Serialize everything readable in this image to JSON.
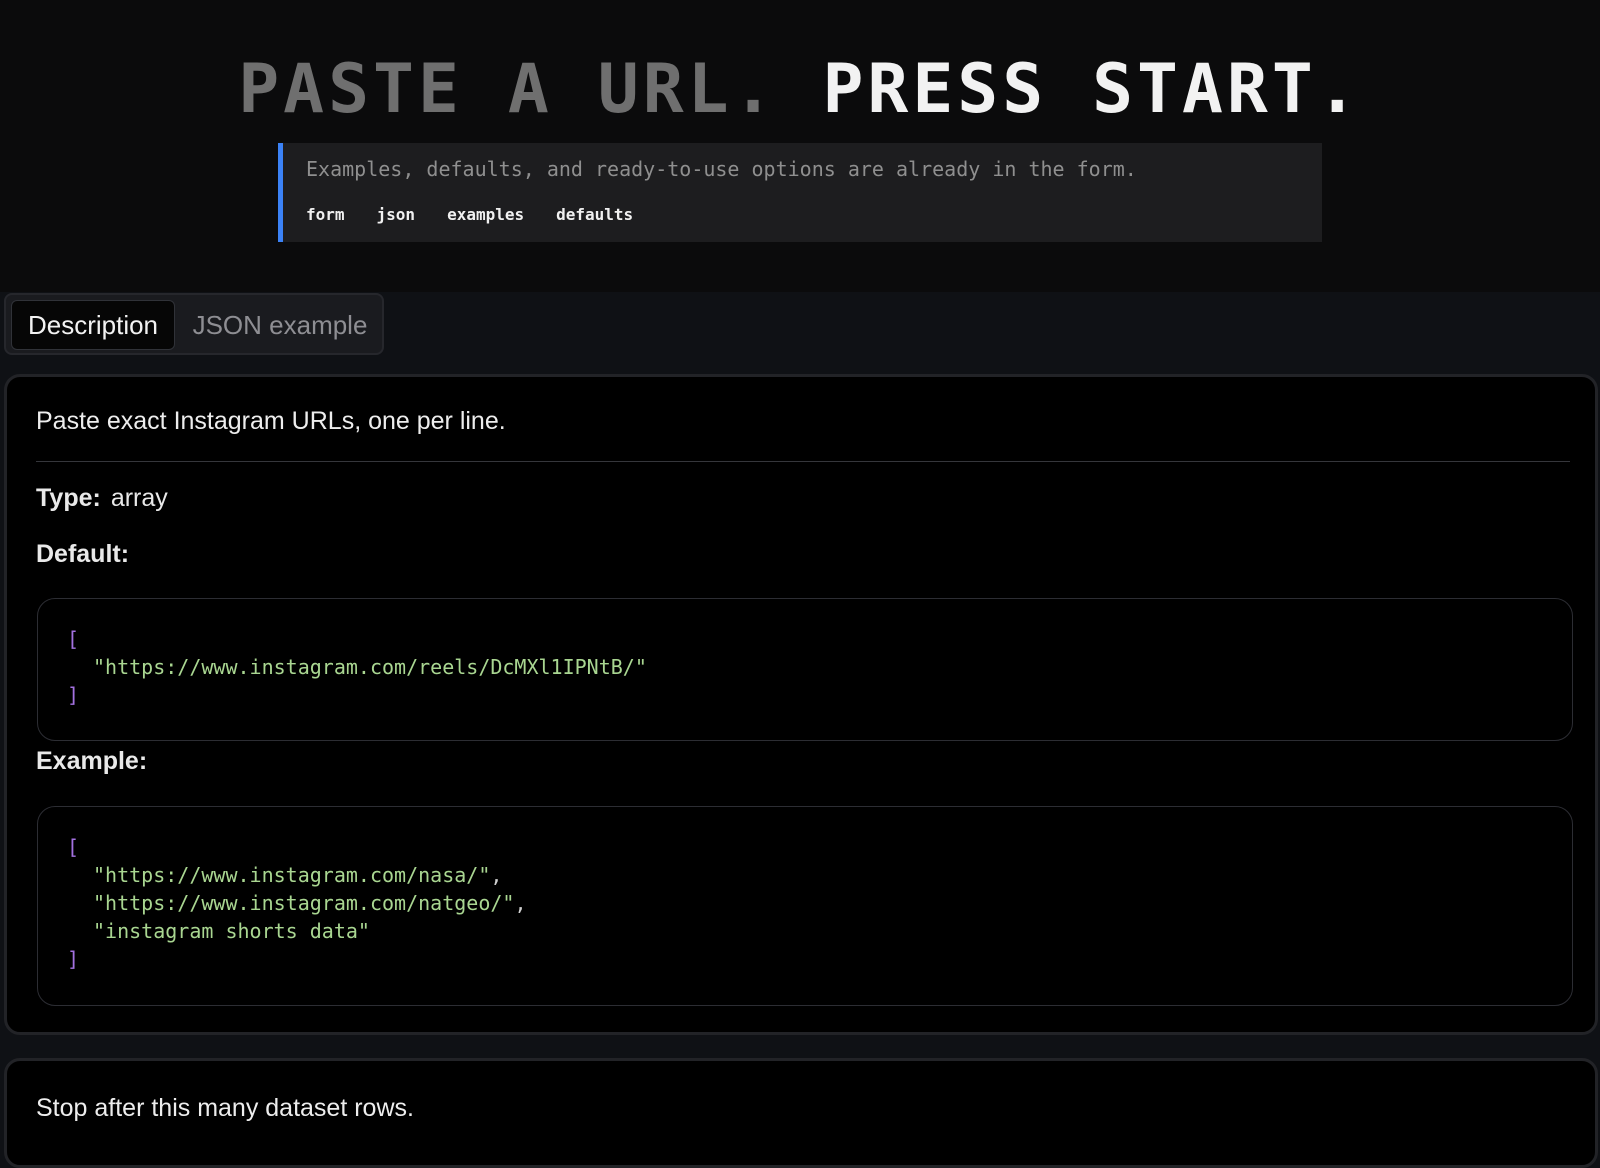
{
  "hero": {
    "title_dim": "PASTE A URL.",
    "title_bright": "PRESS START.",
    "subtitle": "Examples, defaults, and ready-to-use options are already in the form.",
    "tags": [
      "form",
      "json",
      "examples",
      "defaults"
    ],
    "accent_color": "#3b82f6"
  },
  "tabs": {
    "active_label": "Description",
    "inactive_label": "JSON example"
  },
  "field_urls": {
    "description": "Paste exact Instagram URLs, one per line.",
    "type_label": "Type:",
    "type_value": "array",
    "default_label": "Default:",
    "default_open": "[",
    "default_items": [
      "\"https://www.instagram.com/reels/DcMXl1IPNtB/\""
    ],
    "default_close": "]",
    "example_label": "Example:",
    "example_open": "[",
    "example_items": [
      "\"https://www.instagram.com/nasa/\"",
      "\"https://www.instagram.com/natgeo/\"",
      "\"instagram shorts data\""
    ],
    "example_close": "]",
    "comma": ","
  },
  "field_limit": {
    "description": "Stop after this many dataset rows."
  },
  "colors": {
    "bracket": "#a371e0",
    "string": "#a9d691"
  }
}
